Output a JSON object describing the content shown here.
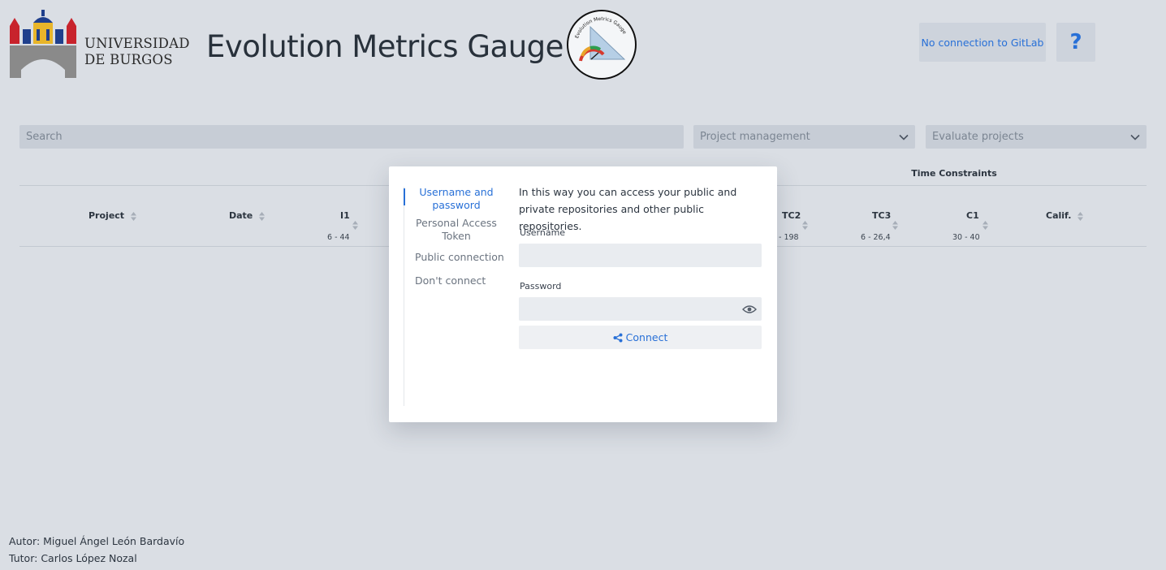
{
  "header": {
    "university_line1": "UNIVERSIDAD",
    "university_line2": "DE BURGOS",
    "app_title": "Evolution Metrics Gauge",
    "logo_ring_text": "Evolution Metrics Gauge",
    "gitlab_status": "No connection to GitLab",
    "help_label": "?"
  },
  "filters": {
    "search_placeholder": "Search",
    "project_management": "Project management",
    "evaluate_projects": "Evaluate projects"
  },
  "table": {
    "group_header": "Time Constraints",
    "columns": [
      {
        "label": "Project",
        "range": ""
      },
      {
        "label": "Date",
        "range": ""
      },
      {
        "label": "I1",
        "range": "6 - 44"
      },
      {
        "label": "TC2",
        "range": "- 198"
      },
      {
        "label": "TC3",
        "range": "6 - 26,4"
      },
      {
        "label": "C1",
        "range": "30 - 40"
      },
      {
        "label": "Calif.",
        "range": ""
      }
    ]
  },
  "modal": {
    "tabs": [
      {
        "label": "Username and password",
        "active": true
      },
      {
        "label": "Personal Access Token",
        "active": false
      },
      {
        "label": "Public connection",
        "active": false
      },
      {
        "label": "Don't connect",
        "active": false
      }
    ],
    "intro": "In this way you can access your public and private repositories and other public repositories.",
    "username_label": "Username",
    "username_value": "",
    "password_label": "Password",
    "password_value": "",
    "connect_label": "Connect"
  },
  "footer": {
    "author": "Autor: Miguel Ángel León Bardavío",
    "tutor": "Tutor: Carlos López Nozal"
  },
  "colors": {
    "background": "#dadee4",
    "accent": "#2870d7",
    "university_red": "#c8232c",
    "university_blue": "#1f3f8c",
    "university_yellow": "#e8b52a"
  }
}
